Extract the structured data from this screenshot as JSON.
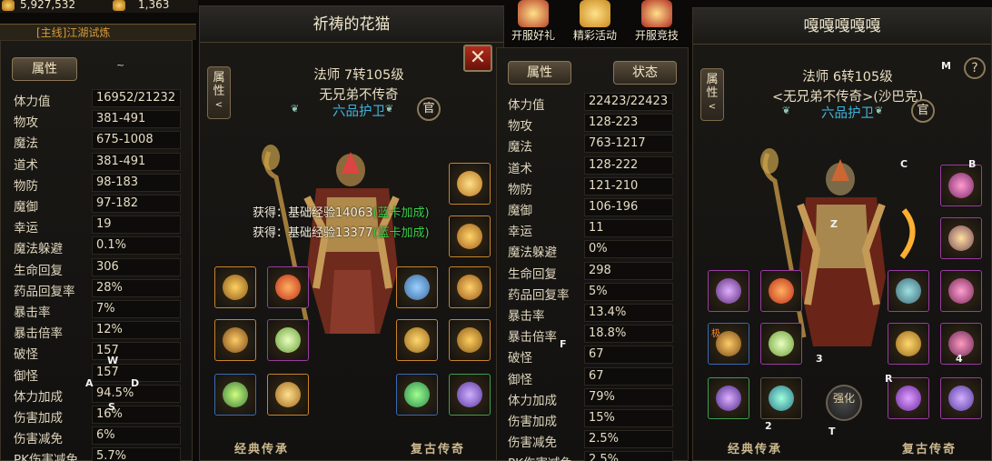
{
  "top": {
    "gold": "5,927,532",
    "ingot": "1,363",
    "quest_text": "[主线]江湖试炼"
  },
  "top_icons": [
    {
      "label": "开服好礼",
      "color": "#b8442a"
    },
    {
      "label": "精彩活动",
      "color": "#c98a1e"
    },
    {
      "label": "开服竞技",
      "color": "#b02a22"
    }
  ],
  "left_stats": {
    "tab_label": "属性",
    "tilde": "~",
    "rows": [
      {
        "label": "体力值",
        "value": "16952/21232"
      },
      {
        "label": "物攻",
        "value": "381-491"
      },
      {
        "label": "魔法",
        "value": "675-1008"
      },
      {
        "label": "道术",
        "value": "381-491"
      },
      {
        "label": "物防",
        "value": "98-183"
      },
      {
        "label": "魔御",
        "value": "97-182"
      },
      {
        "label": "幸运",
        "value": "19"
      },
      {
        "label": "魔法躲避",
        "value": "0.1%"
      },
      {
        "label": "生命回复",
        "value": "306"
      },
      {
        "label": "药品回复率",
        "value": "28%"
      },
      {
        "label": "暴击率",
        "value": "7%"
      },
      {
        "label": "暴击倍率",
        "value": "12%"
      },
      {
        "label": "破怪",
        "value": "157"
      },
      {
        "label": "御怪",
        "value": "157"
      },
      {
        "label": "体力加成",
        "value": "94.5%"
      },
      {
        "label": "伤害加成",
        "value": "16%"
      },
      {
        "label": "伤害减免",
        "value": "6%"
      },
      {
        "label": "PK伤害减免",
        "value": "5.7%"
      }
    ]
  },
  "char1": {
    "title": "祈祷的花猫",
    "class_line": "法师  7转105级",
    "name": "无兄弟不传奇",
    "rank": "六品护卫",
    "guan": "官",
    "side_tab": "属性",
    "bottom_left": "经典传承",
    "bottom_right": "复古传奇",
    "msg1_prefix": "获得：基础经验",
    "msg1_value": "14063",
    "msg1_suffix": "(蓝卡加成)",
    "msg2_prefix": "获得：基础经验",
    "msg2_value": "13377",
    "msg2_suffix": "(蓝卡加成)",
    "close": "✕"
  },
  "right_stats": {
    "tab_attr": "属性",
    "tab_state": "状态",
    "rows": [
      {
        "label": "体力值",
        "value": "22423/22423"
      },
      {
        "label": "物攻",
        "value": "128-223"
      },
      {
        "label": "魔法",
        "value": "763-1217"
      },
      {
        "label": "道术",
        "value": "128-222"
      },
      {
        "label": "物防",
        "value": "121-210"
      },
      {
        "label": "魔御",
        "value": "106-196"
      },
      {
        "label": "幸运",
        "value": "11"
      },
      {
        "label": "魔法躲避",
        "value": "0%"
      },
      {
        "label": "生命回复",
        "value": "298"
      },
      {
        "label": "药品回复率",
        "value": "5%"
      },
      {
        "label": "暴击率",
        "value": "13.4%"
      },
      {
        "label": "暴击倍率",
        "value": "18.8%"
      },
      {
        "label": "破怪",
        "value": "67"
      },
      {
        "label": "御怪",
        "value": "67"
      },
      {
        "label": "体力加成",
        "value": "79%"
      },
      {
        "label": "伤害加成",
        "value": "15%"
      },
      {
        "label": "伤害减免",
        "value": "2.5%"
      },
      {
        "label": "PK伤害减免",
        "value": "2.5%"
      }
    ]
  },
  "char2": {
    "title": "嘎嘎嘎嘎嘎",
    "class_line": "法师  6转105级",
    "name": "<无兄弟不传奇>(沙巴克)",
    "rank": "六品护卫",
    "guan": "官",
    "side_tab": "属性",
    "help": "?",
    "bottom_left": "经典传承",
    "bottom_right": "复古传奇",
    "slot_label_ji": "极",
    "slot_label_qiang": "强化"
  },
  "overlay_letters": [
    "W",
    "A",
    "D",
    "S",
    "F",
    "M",
    "C",
    "B",
    "Z",
    "3",
    "4",
    "2",
    "T",
    "R"
  ]
}
